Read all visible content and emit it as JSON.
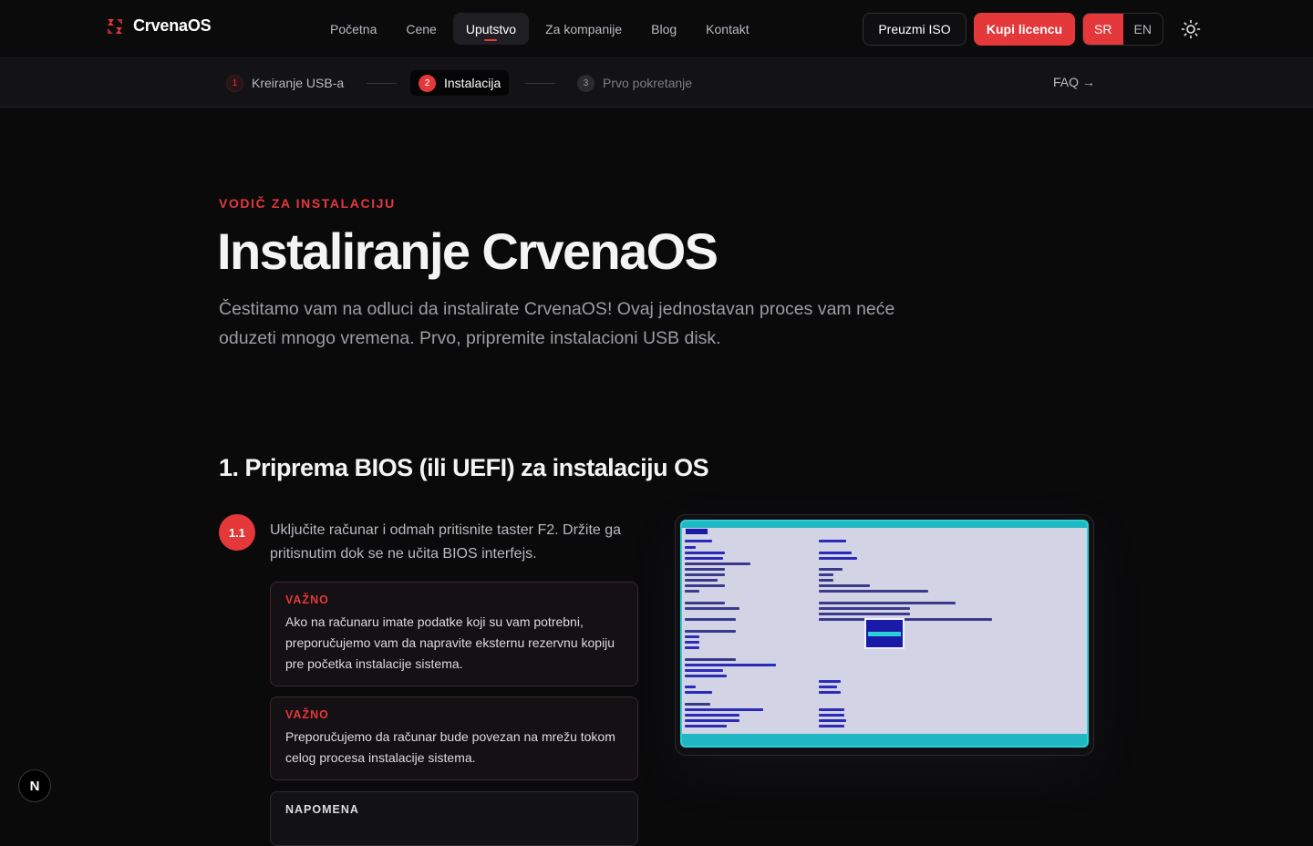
{
  "brand": {
    "name": "CrvenaOS",
    "logo_icon": "crvenaos-logo-icon",
    "accent": "#e5383b"
  },
  "nav": {
    "items": [
      {
        "label": "Početna"
      },
      {
        "label": "Cene"
      },
      {
        "label": "Uputstvo",
        "active": true
      },
      {
        "label": "Za kompanije"
      },
      {
        "label": "Blog"
      },
      {
        "label": "Kontakt"
      }
    ],
    "download_label": "Preuzmi ISO",
    "buy_label": "Kupi licencu",
    "lang": {
      "sr": "SR",
      "en": "EN",
      "selected": "SR"
    },
    "theme_icon": "sun-icon"
  },
  "steps": {
    "items": [
      {
        "num": "1",
        "label": "Kreiranje USB-a"
      },
      {
        "num": "2",
        "label": "Instalacija",
        "active": true
      },
      {
        "num": "3",
        "label": "Prvo pokretanje"
      }
    ],
    "faq_label": "FAQ →"
  },
  "hero": {
    "eyebrow": "VODIČ ZA INSTALACIJU",
    "title": "Instaliranje CrvenaOS",
    "lead": "Čestitamo vam na odluci da instalirate CrvenaOS! Ovaj jednostavan proces vam neće oduzeti mnogo vremena. Prvo, pripremite instalacioni USB disk."
  },
  "section": {
    "title": "1. Priprema BIOS (ili UEFI) za instalaciju OS",
    "step": {
      "badge": "1.1",
      "text": "Uključite računar i odmah pritisnite taster F2. Držite ga pritisnutim dok se ne učita BIOS interfejs."
    },
    "notes": [
      {
        "head": "VAŽNO",
        "body": "Ako na računaru imate podatke koji su vam potrebni, preporučujemo vam da napravite eksternu rezervnu kopiju pre početka instalacije sistema."
      },
      {
        "head": "VAŽNO",
        "body": "Preporučujemo da računar bude povezan na mrežu tokom celog procesa instalacije sistema."
      },
      {
        "head": "NAPOMENA",
        "body": ""
      }
    ]
  },
  "floating": {
    "label": "N"
  }
}
